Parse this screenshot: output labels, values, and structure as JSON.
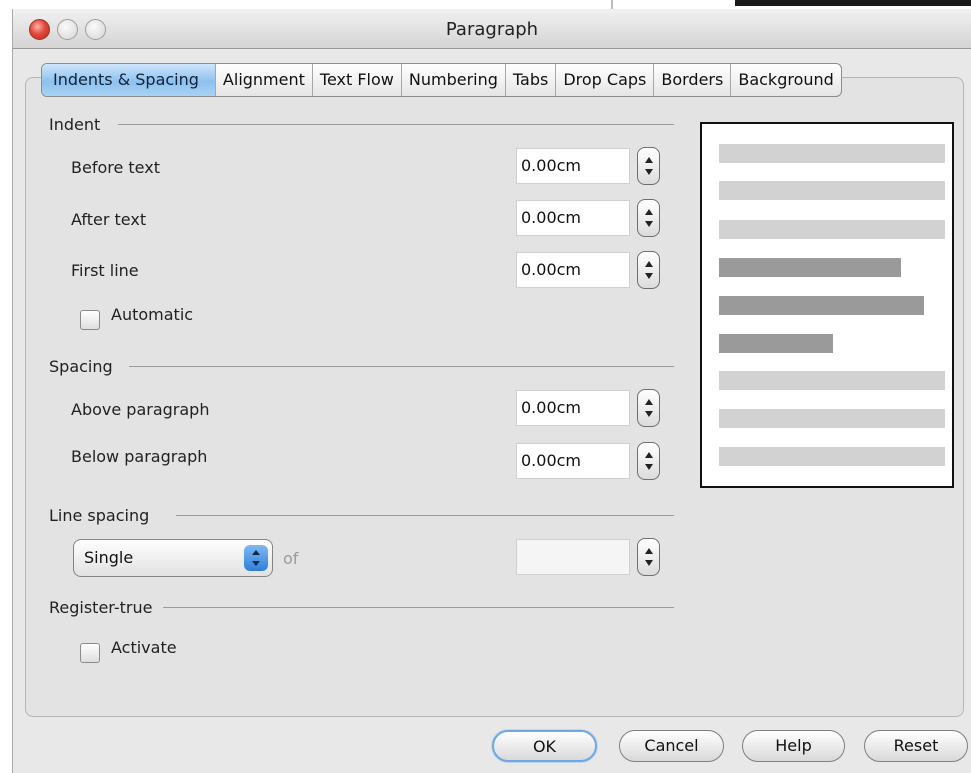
{
  "window": {
    "title": "Paragraph"
  },
  "tabs": [
    {
      "label": "Indents & Spacing",
      "active": true
    },
    {
      "label": "Alignment"
    },
    {
      "label": "Text Flow"
    },
    {
      "label": "Numbering"
    },
    {
      "label": "Tabs"
    },
    {
      "label": "Drop Caps"
    },
    {
      "label": "Borders"
    },
    {
      "label": "Background"
    }
  ],
  "indent": {
    "title": "Indent",
    "before_text": {
      "label": "Before text",
      "value": "0.00cm"
    },
    "after_text": {
      "label": "After text",
      "value": "0.00cm"
    },
    "first_line": {
      "label": "First line",
      "value": "0.00cm"
    },
    "automatic": {
      "label": "Automatic",
      "checked": false
    }
  },
  "spacing": {
    "title": "Spacing",
    "above": {
      "label": "Above paragraph",
      "value": "0.00cm"
    },
    "below": {
      "label": "Below paragraph",
      "value": "0.00cm"
    }
  },
  "line_spacing": {
    "title": "Line spacing",
    "selected": "Single",
    "of_label": "of",
    "value": ""
  },
  "register_true": {
    "title": "Register-true",
    "activate": {
      "label": "Activate",
      "checked": false
    }
  },
  "buttons": {
    "ok": "OK",
    "cancel": "Cancel",
    "help": "Help",
    "reset": "Reset"
  },
  "colors": {
    "active_tab": "#8ec1ee",
    "close_button": "#e2483b",
    "preview_light": "#d2d2d2",
    "preview_dark": "#9a9a9a"
  }
}
